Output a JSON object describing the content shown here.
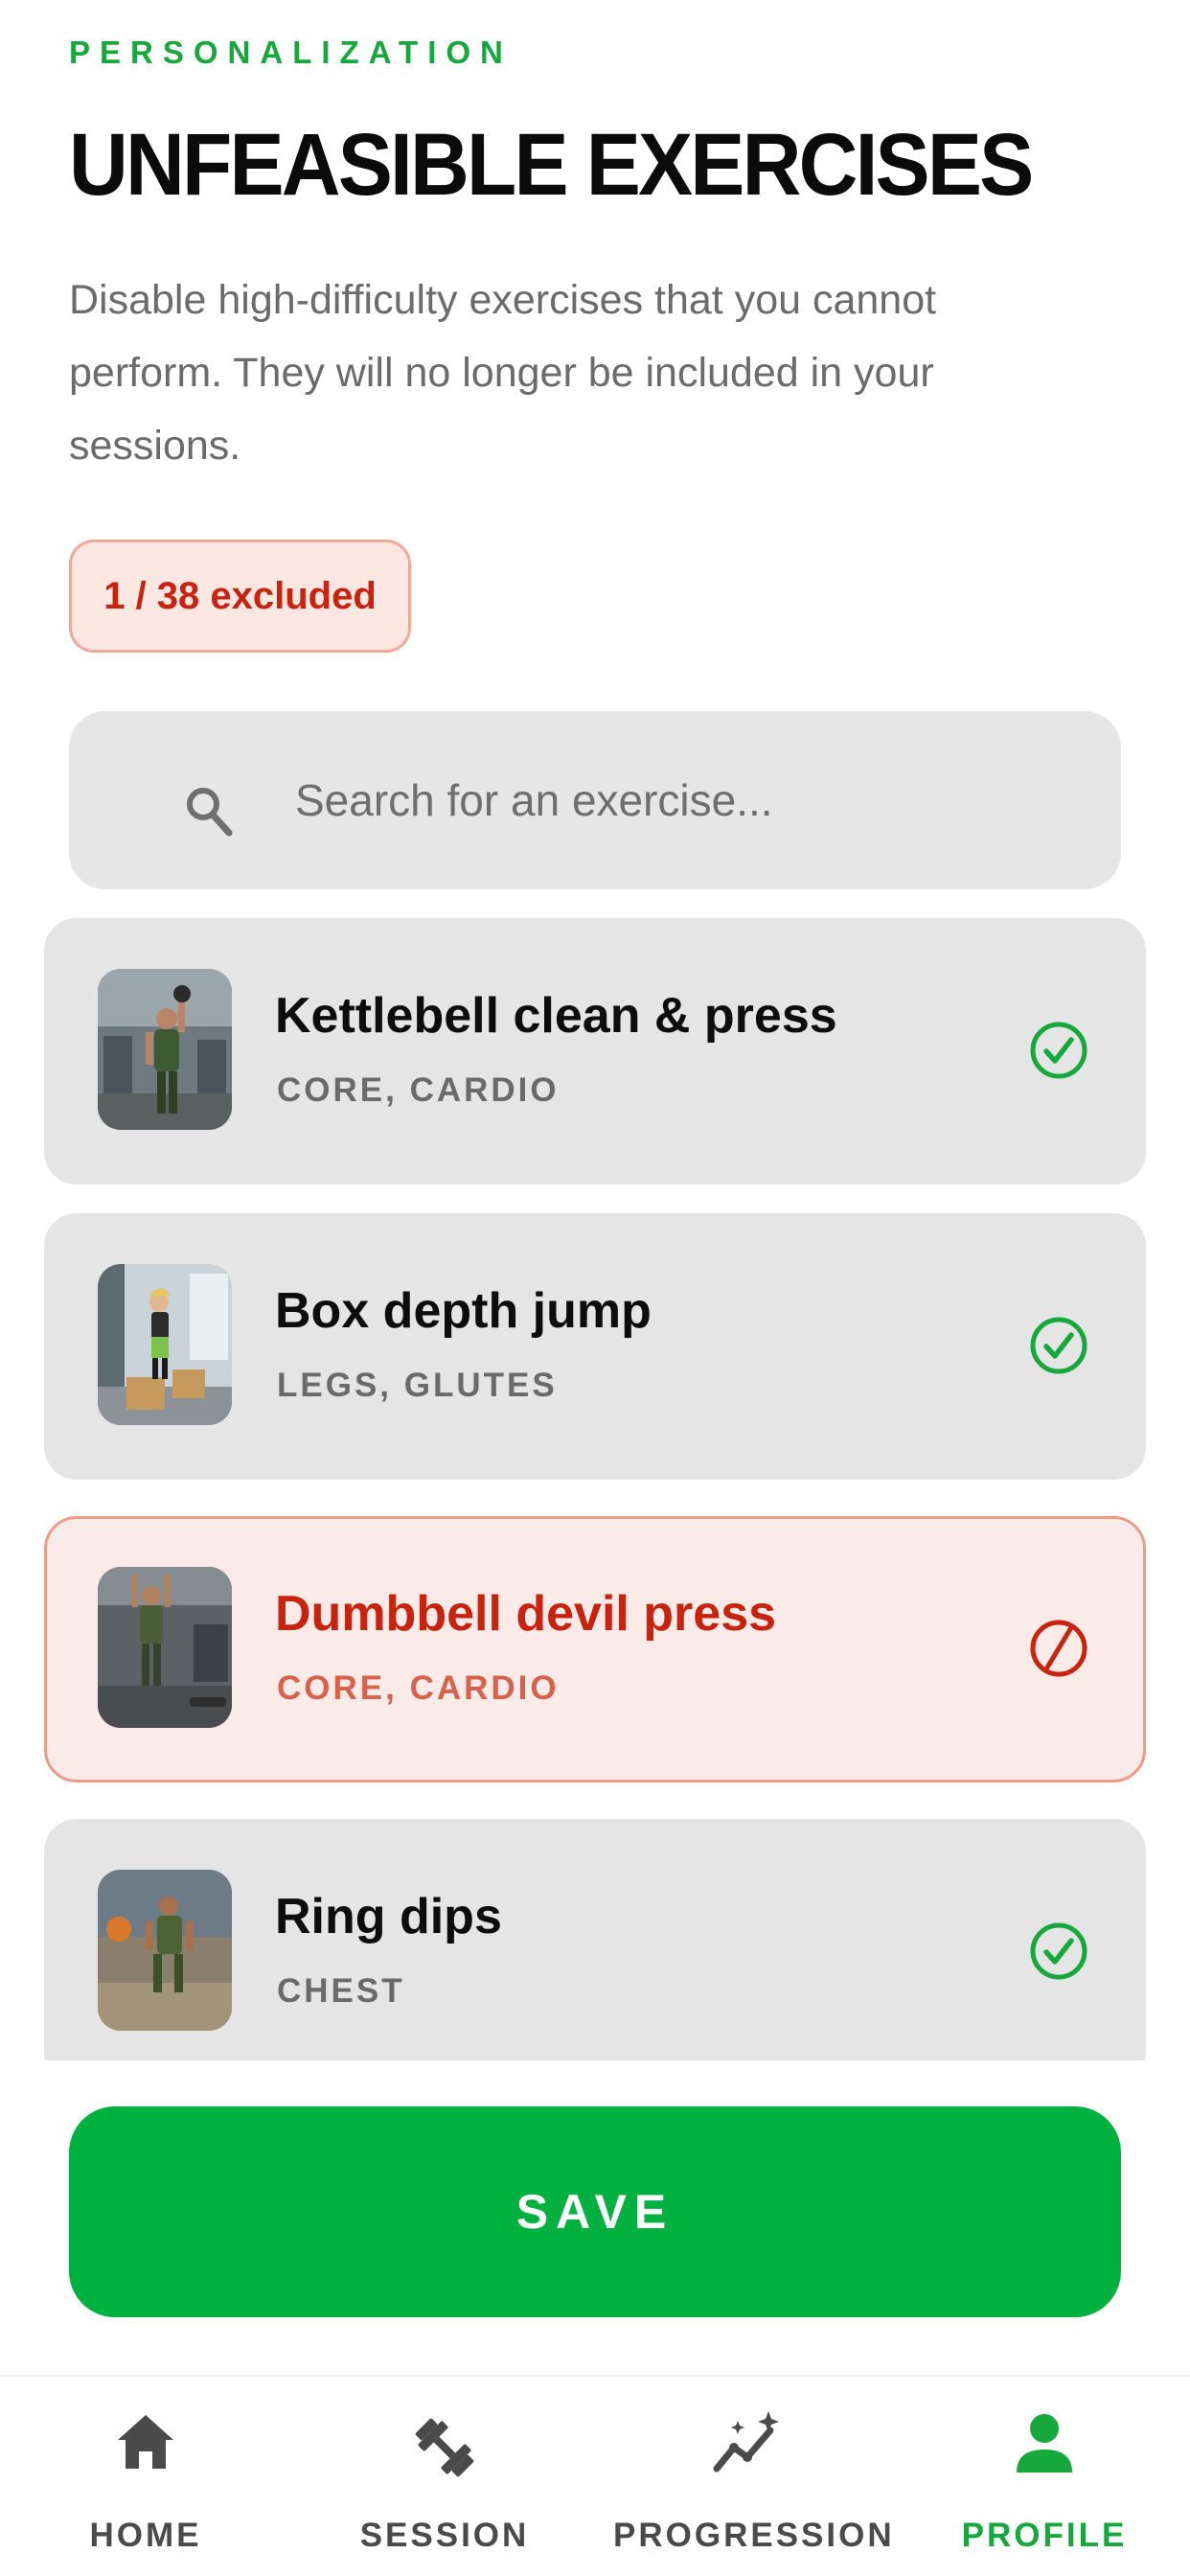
{
  "header": {
    "eyebrow": "PERSONALIZATION",
    "title": "UNFEASIBLE EXERCISES",
    "description": "Disable high-difficulty exercises that you cannot perform. They will no longer be included in your sessions."
  },
  "badge": {
    "text": "1 / 38 excluded"
  },
  "search": {
    "placeholder": "Search for an exercise...",
    "value": ""
  },
  "exercises": [
    {
      "name": "Kettlebell clean & press",
      "tags": "CORE, CARDIO",
      "status": "included",
      "status_icon": "check-circle-icon"
    },
    {
      "name": "Box depth jump",
      "tags": "LEGS, GLUTES",
      "status": "included",
      "status_icon": "check-circle-icon"
    },
    {
      "name": "Dumbbell devil press",
      "tags": "CORE, CARDIO",
      "status": "excluded",
      "status_icon": "prohibited-icon"
    },
    {
      "name": "Ring dips",
      "tags": "CHEST",
      "status": "included",
      "status_icon": "check-circle-icon"
    }
  ],
  "save_button": {
    "label": "SAVE"
  },
  "nav": {
    "items": [
      {
        "label": "HOME",
        "icon": "home-icon",
        "active": false
      },
      {
        "label": "SESSION",
        "icon": "dumbbell-icon",
        "active": false
      },
      {
        "label": "PROGRESSION",
        "icon": "trend-sparkle-icon",
        "active": false
      },
      {
        "label": "PROFILE",
        "icon": "person-icon",
        "active": true
      }
    ]
  },
  "colors": {
    "accent_green": "#16a83c",
    "save_green": "#00b140",
    "excluded_red": "#c8230f",
    "excluded_bg": "#fbebe8",
    "card_bg": "#e5e5e5"
  }
}
